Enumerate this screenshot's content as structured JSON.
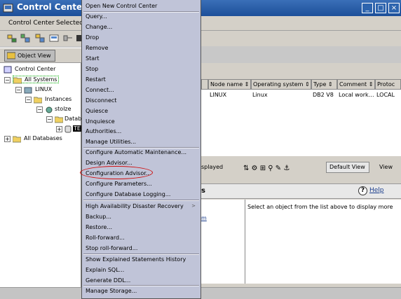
{
  "window": {
    "title": "Control Center",
    "min": "_",
    "max": "□",
    "close": "×"
  },
  "menubar": [
    "Control Center",
    "Selected"
  ],
  "object_view_label": "Object View",
  "tree": {
    "root": "Control Center",
    "all_systems": "All Systems",
    "linux": "LINUX",
    "instances": "Instances",
    "instance": "stolze",
    "databases": "Datab",
    "db": "TE",
    "all_databases": "All Databases"
  },
  "grid": {
    "headers": [
      "Node name ⇕",
      "Operating system ⇕",
      "Type ⇕",
      "Comment ⇕",
      "Protoc"
    ],
    "row": [
      "LINUX",
      "Linux",
      "DB2 V8",
      "Local work…",
      "LOCAL"
    ]
  },
  "right_toolbar": {
    "displayed": "splayed",
    "view_select": "Default View",
    "view_btn": "View"
  },
  "info": {
    "title": "s",
    "help": "Help",
    "message": "Select an object from the list above to display more",
    "link_fragment": "m"
  },
  "menu": {
    "items": [
      "Open New Control Center",
      "Query...",
      "Change...",
      "Drop",
      "Remove",
      "Start",
      "Stop",
      "Restart",
      "Connect...",
      "Disconnect",
      "Quiesce",
      "Unquiesce",
      "Authorities...",
      "Manage Utilities...",
      "Configure Automatic Maintenance...",
      "Design Advisor...",
      "Configuration Advisor...",
      "Configure Parameters...",
      "Configure Database Logging...",
      "High Availability Disaster Recovery",
      "Backup...",
      "Restore...",
      "Roll-forward...",
      "Stop roll-forward...",
      "Show Explained Statements History",
      "Explain SQL...",
      "Generate DDL...",
      "Manage Storage..."
    ],
    "submenu_arrow": ">"
  },
  "colors": {
    "title": "#1c4f99",
    "menu": "#c0c4d8",
    "highlight": "#d01010"
  }
}
